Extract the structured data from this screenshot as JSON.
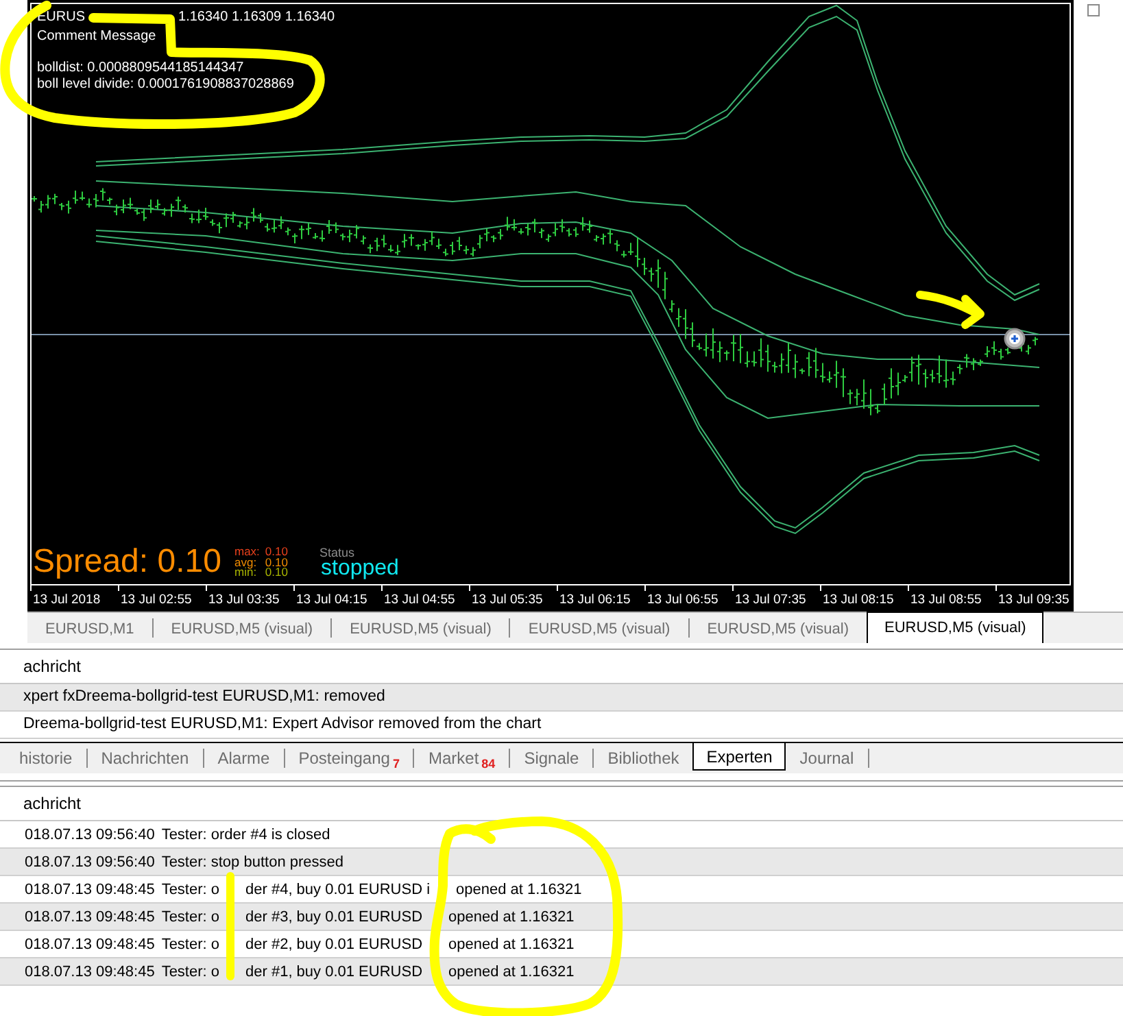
{
  "chart": {
    "title_parts": [
      "EURUS",
      "1.16340 1.16309 1.16340"
    ],
    "comment_lines": [
      "Comment Message"
    ],
    "info_lines": [
      "bolldist: 0.0008809544185144347",
      "boll level divide: 0.0001761908837028869"
    ],
    "spread": {
      "label": "Spread: 0.10",
      "stats": [
        {
          "label": "max:",
          "value": "0.10",
          "color": "#e8401c"
        },
        {
          "label": "avg:",
          "value": "0.10",
          "color": "#f08c00"
        },
        {
          "label": "min:",
          "value": "0.10",
          "color": "#a8b400"
        }
      ]
    },
    "status": {
      "label": "Status",
      "value": "stopped"
    },
    "time_axis": [
      "13 Jul 2018",
      "13 Jul 02:55",
      "13 Jul 03:35",
      "13 Jul 04:15",
      "13 Jul 04:55",
      "13 Jul 05:35",
      "13 Jul 06:15",
      "13 Jul 06:55",
      "13 Jul 07:35",
      "13 Jul 08:15",
      "13 Jul 08:55",
      "13 Jul 09:35"
    ]
  },
  "chart_tabs": [
    {
      "label": "EURUSD,M1",
      "selected": false
    },
    {
      "label": "EURUSD,M5 (visual)",
      "selected": false
    },
    {
      "label": "EURUSD,M5 (visual)",
      "selected": false
    },
    {
      "label": "EURUSD,M5 (visual)",
      "selected": false
    },
    {
      "label": "EURUSD,M5 (visual)",
      "selected": false
    },
    {
      "label": "EURUSD,M5 (visual)",
      "selected": true
    }
  ],
  "upper_log": {
    "header": "achricht",
    "rows": [
      "xpert fxDreema-bollgrid-test EURUSD,M1: removed",
      "Dreema-bollgrid-test EURUSD,M1: Expert Advisor removed from the chart"
    ]
  },
  "panel_tabs": [
    {
      "label": "historie",
      "selected": false
    },
    {
      "label": "Nachrichten",
      "selected": false
    },
    {
      "label": "Alarme",
      "selected": false
    },
    {
      "label": "Posteingang",
      "badge": "7",
      "selected": false
    },
    {
      "label": "Market",
      "badge": "84",
      "selected": false
    },
    {
      "label": "Signale",
      "selected": false
    },
    {
      "label": "Bibliothek",
      "selected": false
    },
    {
      "label": "Experten",
      "selected": true
    },
    {
      "label": "Journal",
      "selected": false
    }
  ],
  "lower_log": {
    "header": "achricht",
    "rows": [
      {
        "time": "018.07.13 09:56:40",
        "message_parts": [
          "Tester: order #4 is closed"
        ]
      },
      {
        "time": "018.07.13 09:56:40",
        "message_parts": [
          "Tester: stop button pressed"
        ]
      },
      {
        "time": "018.07.13 09:48:45",
        "message_parts": [
          "Tester: o",
          "der #4, buy 0.01 EURUSD i",
          "opened at 1.16321"
        ]
      },
      {
        "time": "018.07.13 09:48:45",
        "message_parts": [
          "Tester: o",
          "der #3, buy 0.01 EURUSD",
          "opened at 1.16321"
        ]
      },
      {
        "time": "018.07.13 09:48:45",
        "message_parts": [
          "Tester: o",
          "der #2, buy 0.01 EURUSD",
          "opened at 1.16321"
        ]
      },
      {
        "time": "018.07.13 09:48:45",
        "message_parts": [
          "Tester: o",
          "der #1, buy 0.01 EURUSD",
          "opened at 1.16321"
        ]
      }
    ]
  }
}
